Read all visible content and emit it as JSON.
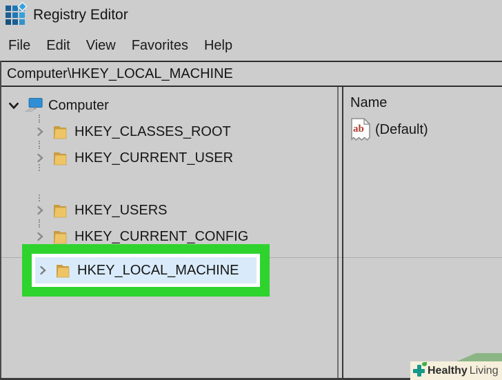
{
  "window": {
    "title": "Registry Editor"
  },
  "menu": {
    "items": [
      {
        "label": "File"
      },
      {
        "label": "Edit"
      },
      {
        "label": "View"
      },
      {
        "label": "Favorites"
      },
      {
        "label": "Help"
      }
    ]
  },
  "address_bar": {
    "value": "Computer\\HKEY_LOCAL_MACHINE"
  },
  "tree": {
    "root": {
      "label": "Computer",
      "state": "expanded",
      "icon": "computer-icon"
    },
    "items": [
      {
        "label": "HKEY_CLASSES_ROOT",
        "state": "collapsed",
        "icon": "folder-icon",
        "selected": false
      },
      {
        "label": "HKEY_CURRENT_USER",
        "state": "collapsed",
        "icon": "folder-icon",
        "selected": false
      },
      {
        "label": "HKEY_LOCAL_MACHINE",
        "state": "collapsed",
        "icon": "folder-icon",
        "selected": true,
        "annotated": "green-highlight-box"
      },
      {
        "label": "HKEY_USERS",
        "state": "collapsed",
        "icon": "folder-icon",
        "selected": false
      },
      {
        "label": "HKEY_CURRENT_CONFIG",
        "state": "collapsed",
        "icon": "folder-icon",
        "selected": false
      }
    ]
  },
  "right_pane": {
    "columns": [
      {
        "label": "Name"
      }
    ],
    "values": [
      {
        "name": "(Default)",
        "type_icon": "string-ab-icon"
      }
    ]
  },
  "watermark": {
    "brand_bold": "Healthy",
    "brand_regular": "Living"
  },
  "colors": {
    "window_bg": "#cdcdcd",
    "highlight_green": "#2ed32e",
    "selection_fill": "#d9ebfa",
    "selection_border": "#ffffff",
    "folder": "#e5bb62",
    "monitor_blue": "#2e8fd5",
    "ab_red": "#b03a2e",
    "watermark_cream": "#f6efdc",
    "watermark_ribbon": "#8cb585",
    "watermark_teal": "#17988b"
  }
}
